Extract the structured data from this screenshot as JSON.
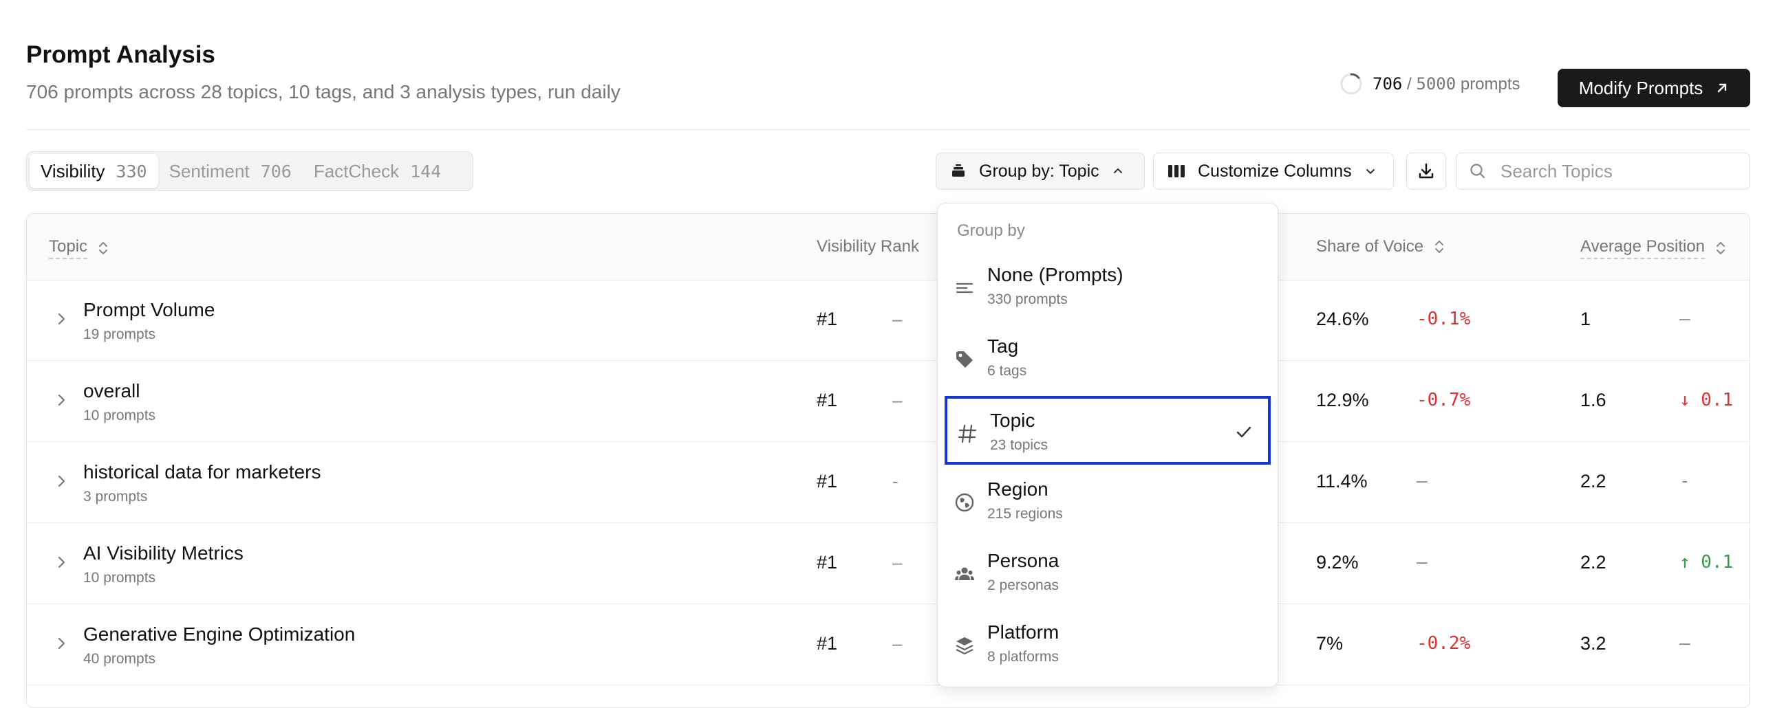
{
  "header": {
    "title": "Prompt Analysis",
    "subtitle": "706 prompts across 28 topics, 10 tags, and 3 analysis types, run daily",
    "usage_used": "706",
    "usage_sep": "/",
    "usage_total": "5000",
    "usage_unit": "prompts",
    "usage_fraction": 0.1412,
    "modify_label": "Modify Prompts"
  },
  "tabs": [
    {
      "label": "Visibility",
      "count": "330",
      "active": true
    },
    {
      "label": "Sentiment",
      "count": "706",
      "active": false
    },
    {
      "label": "FactCheck",
      "count": "144",
      "active": false
    }
  ],
  "toolbar": {
    "group_by_label": "Group by: Topic",
    "customize_label": "Customize Columns",
    "search_placeholder": "Search Topics"
  },
  "table": {
    "columns": {
      "topic": "Topic",
      "visibility_rank": "Visibility Rank",
      "share_of_voice": "Share of Voice",
      "average_position": "Average Position"
    },
    "rows": [
      {
        "name": "Prompt Volume",
        "count": "19 prompts",
        "rank": "#1",
        "rank_delta": "–",
        "sov": "24.6%",
        "sov_delta": "-0.1%",
        "sov_trend": "neg",
        "pos": "1",
        "pos_delta": "–",
        "pos_trend": "none"
      },
      {
        "name": "overall",
        "count": "10 prompts",
        "rank": "#1",
        "rank_delta": "–",
        "sov": "12.9%",
        "sov_delta": "-0.7%",
        "sov_trend": "neg",
        "pos": "1.6",
        "pos_delta": "↓ 0.1",
        "pos_trend": "neg"
      },
      {
        "name": "historical data for marketers",
        "count": "3 prompts",
        "rank": "#1",
        "rank_delta": "-",
        "sov": "11.4%",
        "sov_delta": "–",
        "sov_trend": "none",
        "pos": "2.2",
        "pos_delta": "-",
        "pos_trend": "none"
      },
      {
        "name": "AI Visibility Metrics",
        "count": "10 prompts",
        "rank": "#1",
        "rank_delta": "–",
        "sov": "9.2%",
        "sov_delta": "–",
        "sov_trend": "none",
        "pos": "2.2",
        "pos_delta": "↑ 0.1",
        "pos_trend": "pos"
      },
      {
        "name": "Generative Engine Optimization",
        "count": "40 prompts",
        "rank": "#1",
        "rank_delta": "–",
        "sov": "7%",
        "sov_delta": "-0.2%",
        "sov_trend": "neg",
        "pos": "3.2",
        "pos_delta": "–",
        "pos_trend": "none"
      }
    ]
  },
  "group_by_menu": {
    "heading": "Group by",
    "items": [
      {
        "label": "None (Prompts)",
        "sub": "330 prompts",
        "icon": "lines-icon",
        "selected": false
      },
      {
        "label": "Tag",
        "sub": "6 tags",
        "icon": "tag-icon",
        "selected": false
      },
      {
        "label": "Topic",
        "sub": "23 topics",
        "icon": "hash-icon",
        "selected": true
      },
      {
        "label": "Region",
        "sub": "215 regions",
        "icon": "globe-icon",
        "selected": false
      },
      {
        "label": "Persona",
        "sub": "2 personas",
        "icon": "people-icon",
        "selected": false
      },
      {
        "label": "Platform",
        "sub": "8 platforms",
        "icon": "layers-icon",
        "selected": false
      }
    ]
  },
  "colors": {
    "negative": "#e03131",
    "positive": "#2f9e44",
    "selection_outline": "#1534d6",
    "primary_button": "#1a1a1a"
  }
}
